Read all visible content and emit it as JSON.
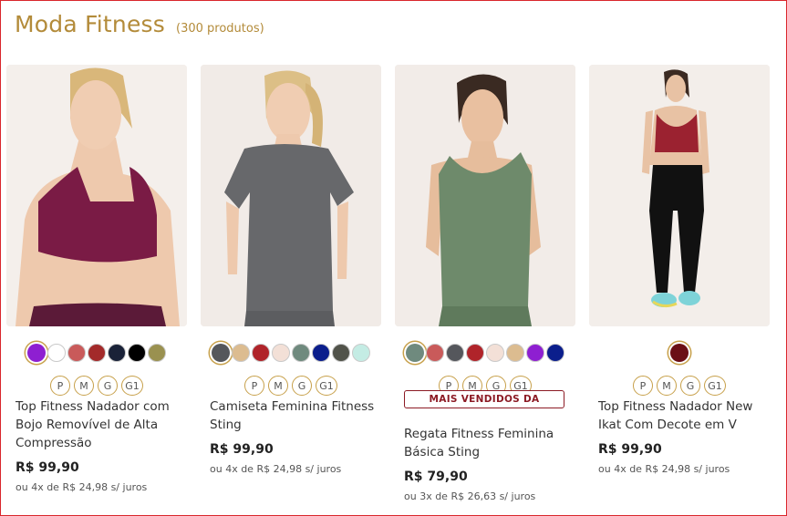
{
  "header": {
    "title": "Moda Fitness",
    "count": "(300 produtos)"
  },
  "colors": {
    "accent": "#b38b3a",
    "badge": "#8c1a24"
  },
  "products": [
    {
      "name": "Top Fitness Nadador com Bojo Removível de Alta Compressão",
      "price": "R$ 99,90",
      "installments": "ou 4x de R$ 24,98 s/ juros",
      "badge": "",
      "sizes": [
        "P",
        "M",
        "G",
        "G1"
      ],
      "swatches": [
        "#8e1fd1",
        "#ffffff",
        "#c95a5a",
        "#a32a2a",
        "#1a2238",
        "#000000",
        "#9a9150"
      ],
      "selected_swatch": 0,
      "image": "woman-in-plum-sports-top"
    },
    {
      "name": "Camiseta Feminina Fitness Sting",
      "price": "R$ 99,90",
      "installments": "ou 4x de R$ 24,98 s/ juros",
      "badge": "",
      "sizes": [
        "P",
        "M",
        "G",
        "G1"
      ],
      "swatches": [
        "#55575c",
        "#dcbc90",
        "#b0242a",
        "#f3e0d7",
        "#6f8a7e",
        "#0b1e8c",
        "#51534a",
        "#c4ece4"
      ],
      "selected_swatch": 0,
      "image": "woman-in-grey-tshirt"
    },
    {
      "name": "Regata Fitness Feminina Básica Sting",
      "price": "R$ 79,90",
      "installments": "ou 3x de R$ 26,63 s/ juros",
      "badge": "MAIS VENDIDOS DA",
      "sizes": [
        "P",
        "M",
        "G",
        "G1"
      ],
      "swatches": [
        "#6f8a7e",
        "#c95a5a",
        "#55575c",
        "#b0242a",
        "#f3e0d7",
        "#dcbc90",
        "#8e1fd1",
        "#0b1e8c"
      ],
      "selected_swatch": 0,
      "image": "woman-in-green-tank-top"
    },
    {
      "name": "Top Fitness Nadador New Ikat Com Decote em V",
      "price": "R$ 99,90",
      "installments": "ou 4x de R$ 24,98 s/ juros",
      "badge": "",
      "sizes": [
        "P",
        "M",
        "G",
        "G1"
      ],
      "swatches": [
        "#6b0f16"
      ],
      "selected_swatch": 0,
      "image": "woman-in-red-top-and-black-leggings"
    }
  ]
}
